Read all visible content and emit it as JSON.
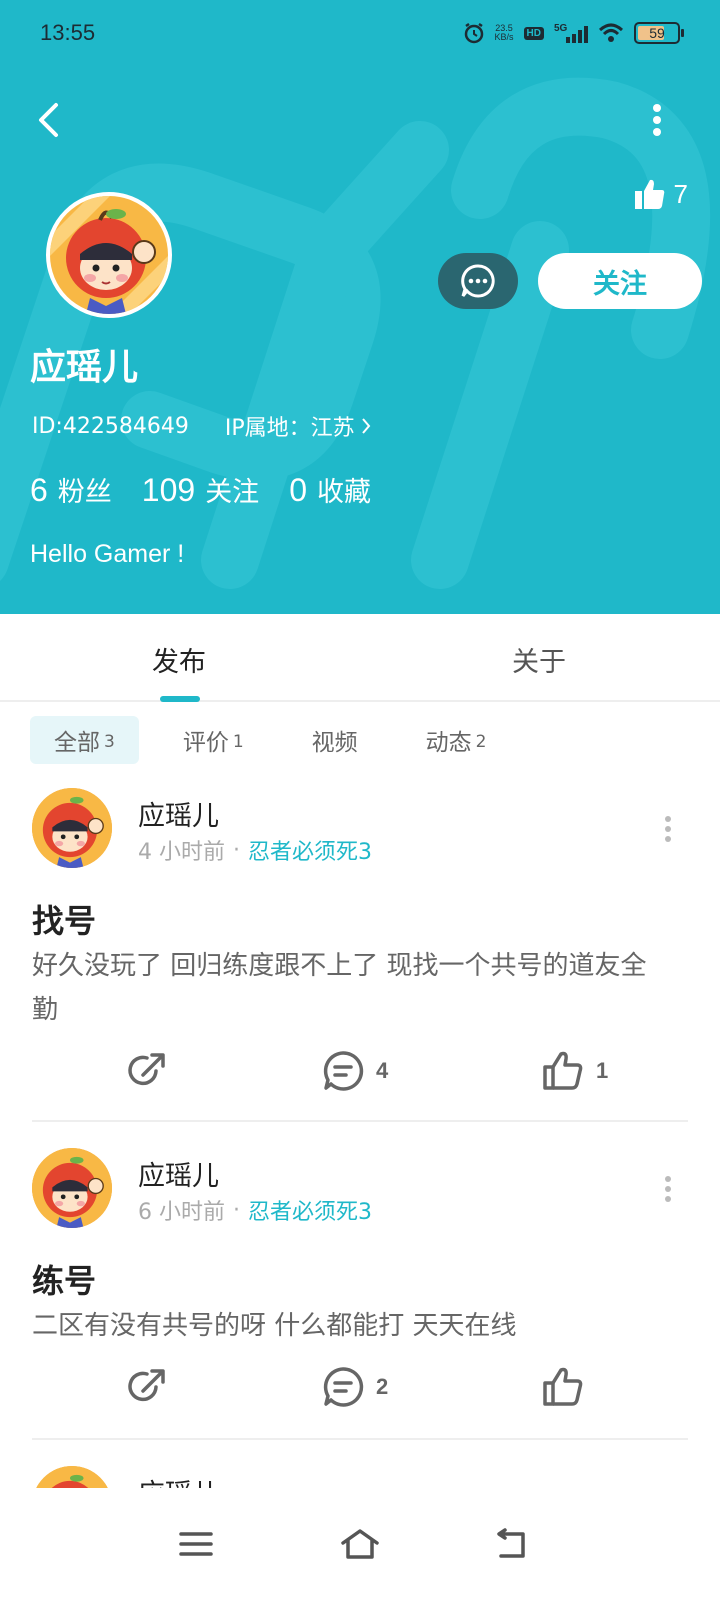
{
  "status_bar": {
    "time": "13:55",
    "net_speed": "23.5",
    "net_unit": "KB/s",
    "hd": "HD",
    "signal": "5G",
    "battery": "59",
    "icons": [
      "alarm-icon",
      "hd-icon",
      "signal-5g-icon",
      "wifi-icon",
      "battery-icon"
    ]
  },
  "header": {
    "like_count": "7",
    "follow_label": "关注",
    "username": "应瑶儿",
    "user_id": "ID:422584649",
    "ip_location": "IP属地：江苏",
    "stats": [
      {
        "num": "6",
        "label": "粉丝"
      },
      {
        "num": "109",
        "label": "关注"
      },
      {
        "num": "0",
        "label": "收藏"
      }
    ],
    "bio": "Hello Gamer !",
    "colors": {
      "accent": "#1fb8c9",
      "message_button": "#2a6670"
    }
  },
  "tabs": [
    {
      "label": "发布",
      "active": true
    },
    {
      "label": "关于",
      "active": false
    }
  ],
  "filters": [
    {
      "label": "全部",
      "count": "3",
      "active": true
    },
    {
      "label": "评价",
      "count": "1",
      "active": false
    },
    {
      "label": "视频",
      "count": "",
      "active": false
    },
    {
      "label": "动态",
      "count": "2",
      "active": false
    }
  ],
  "posts": [
    {
      "author": "应瑶儿",
      "time": "4 小时前",
      "separator": "·",
      "game": "忍者必须死3",
      "title": "找号",
      "body": "好久没玩了 回归练度跟不上了 现找一个共号的道友全勤",
      "comments": "4",
      "likes": "1"
    },
    {
      "author": "应瑶儿",
      "time": "6 小时前",
      "separator": "·",
      "game": "忍者必须死3",
      "title": "练号",
      "body": "二区有没有共号的呀 什么都能打 天天在线",
      "comments": "2",
      "likes": ""
    },
    {
      "author": "应瑶儿"
    }
  ]
}
